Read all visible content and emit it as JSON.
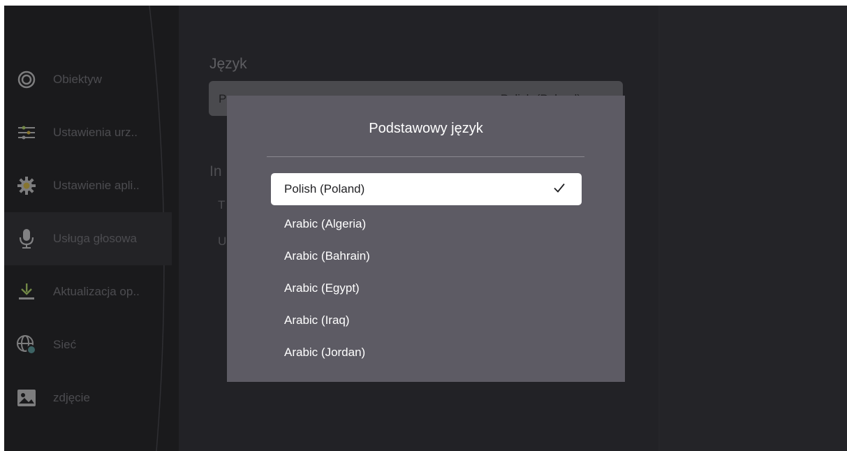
{
  "sidebar": {
    "items": [
      {
        "label": "Obiektyw",
        "icon": "lens-icon"
      },
      {
        "label": "Ustawienia urz..",
        "icon": "sliders-icon"
      },
      {
        "label": "Ustawienie apli..",
        "icon": "gear-icon"
      },
      {
        "label": "Usługa głosowa",
        "icon": "microphone-icon"
      },
      {
        "label": "Aktualizacja op..",
        "icon": "download-icon"
      },
      {
        "label": "Sieć",
        "icon": "globe-icon"
      },
      {
        "label": "zdjęcie",
        "icon": "image-icon"
      }
    ],
    "active_index": 3
  },
  "main": {
    "section_title": "Język",
    "primary_row_label": "P",
    "primary_row_value": "Polish (Poland)",
    "obscured_section_title": "In",
    "obscured_row_1": "T",
    "obscured_row_2": "U"
  },
  "dialog": {
    "title": "Podstawowy język",
    "options": [
      {
        "label": "Polish (Poland)",
        "selected": true
      },
      {
        "label": "Arabic (Algeria)",
        "selected": false
      },
      {
        "label": "Arabic (Bahrain)",
        "selected": false
      },
      {
        "label": "Arabic (Egypt)",
        "selected": false
      },
      {
        "label": "Arabic (Iraq)",
        "selected": false
      },
      {
        "label": "Arabic (Jordan)",
        "selected": false
      }
    ]
  },
  "colors": {
    "background": "#222226",
    "sidebar": "#1a1a1c",
    "dialog": "#5d5b64",
    "selected_option": "#ffffff"
  }
}
